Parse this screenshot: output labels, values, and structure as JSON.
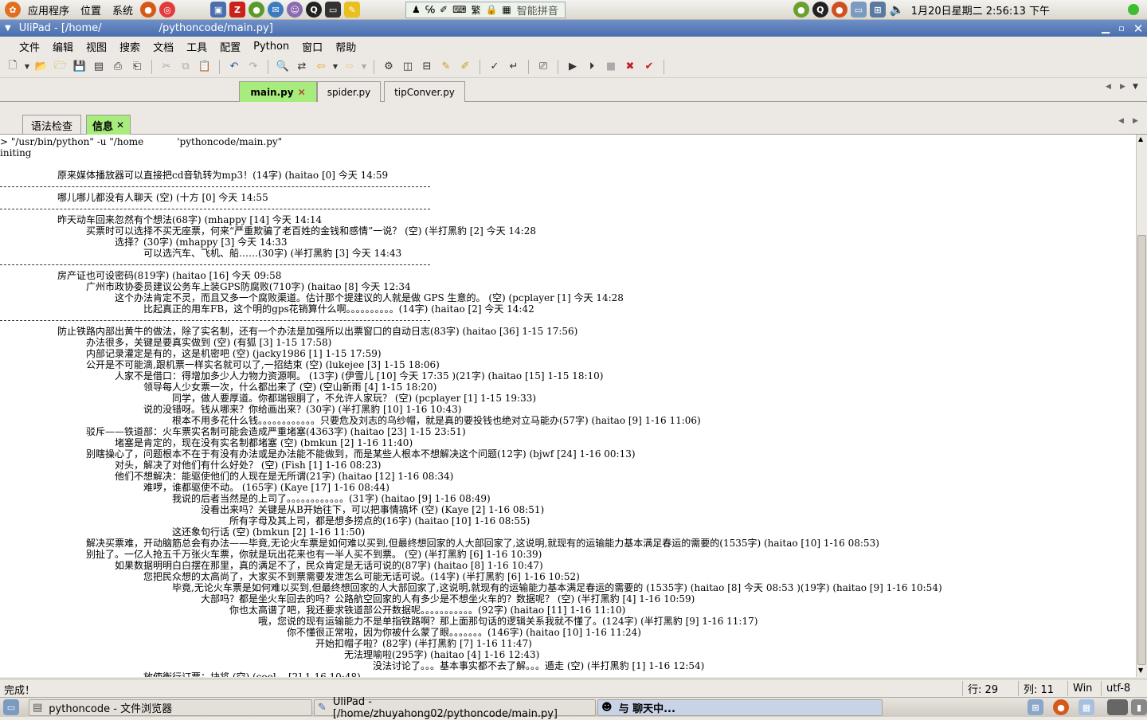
{
  "top_panel": {
    "menus": [
      "应用程序",
      "位置",
      "系统"
    ],
    "ime_label": "智能拼音",
    "clock": "1月20日星期二  2:56:13 下午"
  },
  "window": {
    "title_left": "UliPad - [/home/",
    "title_right": "/pythoncode/main.py]"
  },
  "menubar": [
    "文件",
    "编辑",
    "视图",
    "搜索",
    "文档",
    "工具",
    "配置",
    "Python",
    "窗口",
    "帮助"
  ],
  "editor_tabs": [
    {
      "label": "main.py",
      "active": true
    },
    {
      "label": "spider.py",
      "active": false
    },
    {
      "label": "tipConver.py",
      "active": false
    }
  ],
  "panel_tabs": [
    {
      "label": "语法检查",
      "active": false
    },
    {
      "label": "信息",
      "active": true
    }
  ],
  "output_lines": [
    {
      "indent": 0,
      "text": "> \"/usr/bin/python\" -u \"/home           'pythoncode/main.py\""
    },
    {
      "indent": 0,
      "text": "initing"
    },
    {
      "indent": 0,
      "text": ""
    },
    {
      "indent": 1,
      "text": "原来媒体播放器可以直接把cd音轨转为mp3！(14字) (haitao [0] 今天 14:59"
    },
    {
      "indent": -1,
      "text": ""
    },
    {
      "indent": 1,
      "text": "哪儿哪儿都没有人聊天 (空) (十方 [0] 今天 14:55"
    },
    {
      "indent": -1,
      "text": ""
    },
    {
      "indent": 1,
      "text": "昨天动车回来忽然有个想法(68字) (mhappy [14] 今天 14:14"
    },
    {
      "indent": 2,
      "text": "买票时可以选择不买无座票，何来“严重欺骗了老百姓的金钱和感情”一说？ (空) (半打黑豹 [2] 今天 14:28"
    },
    {
      "indent": 3,
      "text": "选择？(30字) (mhappy [3] 今天 14:33"
    },
    {
      "indent": 4,
      "text": "可以选汽车、飞机、船……(30字) (半打黑豹 [3] 今天 14:43"
    },
    {
      "indent": -1,
      "text": ""
    },
    {
      "indent": 1,
      "text": "房产证也可设密码(819字) (haitao [16] 今天 09:58"
    },
    {
      "indent": 2,
      "text": "广州市政协委员建议公务车上装GPS防腐败(710字) (haitao [8] 今天 12:34"
    },
    {
      "indent": 3,
      "text": "这个办法肯定不灵，而且又多一个腐败渠道。估计那个提建议的人就是做 GPS 生意的。 (空) (pcplayer [1] 今天 14:28"
    },
    {
      "indent": 4,
      "text": "比起真正的用车FB，这个明的gps花销算什么啊。。。。。。。。。。(14字) (haitao [2] 今天 14:42"
    },
    {
      "indent": -1,
      "text": ""
    },
    {
      "indent": 1,
      "text": "防止铁路内部出黄牛的做法，除了实名制，还有一个办法是加强所以出票窗口的自动日志(83字) (haitao [36] 1-15 17:56)"
    },
    {
      "indent": 2,
      "text": "办法很多，关键是要真实做到 (空) (有狐 [3] 1-15 17:58)"
    },
    {
      "indent": 2,
      "text": "内部记录灌定是有的，这是机密吧 (空) (jacky1986 [1] 1-15 17:59)"
    },
    {
      "indent": 2,
      "text": "公开是不可能滴,跟机票一样实名就可以了,一招结束 (空) (lukejee [3] 1-15 18:06)"
    },
    {
      "indent": 3,
      "text": "人家不是借口：得增加多少人力物力资源啊。 (13字) (伊雪儿 [10] 今天 17:35 )(21字) (haitao [15] 1-15 18:10)"
    },
    {
      "indent": 4,
      "text": "领导每人少女票一次，什么都出来了 (空) (空山新雨 [4] 1-15 18:20)"
    },
    {
      "indent": 5,
      "text": "同学，做人要厚道。你都瑞银胴了，不允许人家玩？ (空) (pcplayer [1] 1-15 19:33)"
    },
    {
      "indent": 4,
      "text": "说的没错呀。钱从哪来？你给画出来？(30字) (半打黑豹 [10] 1-16 10:43)"
    },
    {
      "indent": 5,
      "text": "根本不用多花什么钱。。。。。。。。。。。。只要危及刘志的乌纱帽，就是真的要投钱也绝对立马能办(57字) (haitao [9] 1-16 11:06)"
    },
    {
      "indent": 2,
      "text": "驳斥——铁道部：火车票实名制可能会造成严重堵塞(4363字) (haitao [23] 1-15 23:51)"
    },
    {
      "indent": 3,
      "text": "堵塞是肯定的，现在没有实名制都堵塞 (空) (bmkun [2] 1-16 11:40)"
    },
    {
      "indent": 2,
      "text": "别瞎操心了，问题根本不在于有没有办法或是办法能不能做到，而是某些人根本不想解决这个问题(12字) (bjwf [24] 1-16 00:13)"
    },
    {
      "indent": 3,
      "text": "对头，解决了对他们有什么好处？ (空) (Fish [1] 1-16 08:23)"
    },
    {
      "indent": 3,
      "text": "他们不想解决：能驱使他们的人现在是无所谓(21字) (haitao [12] 1-16 08:34)"
    },
    {
      "indent": 4,
      "text": "难啰，谁都驱使不动。 (165字) (Kaye [17] 1-16 08:44)"
    },
    {
      "indent": 5,
      "text": "我说的后者当然是的上司了。。。。。。。。。。。。(31字) (haitao [9] 1-16 08:49)"
    },
    {
      "indent": 6,
      "text": "没看出来吗？关键是从B开始往下，可以把事情搞坏 (空) (Kaye [2] 1-16 08:51)"
    },
    {
      "indent": 7,
      "text": "所有字母及其上司，都是想多捞点的(16字) (haitao [10] 1-16 08:55)"
    },
    {
      "indent": 5,
      "text": "这还象句行话 (空) (bmkun [2] 1-16 11:50)"
    },
    {
      "indent": 2,
      "text": "解决买票难，开动脑筋总会有办法——毕竟,无论火车票是如何难以买到,但最终想回家的人大部回家了,这说明,就现有的运输能力基本满足春运的需要的(1535字) (haitao [10] 1-16 08:53)"
    },
    {
      "indent": 2,
      "text": "别扯了。一亿人抢五千万张火车票，你就是玩出花来也有一半人买不到票。 (空) (半打黑豹 [6] 1-16 10:39)"
    },
    {
      "indent": 3,
      "text": "如果数据明明白白摆在那里，真的满足不了，民众肯定是无话可说的(87字) (haitao [8] 1-16 10:47)"
    },
    {
      "indent": 4,
      "text": "您把民众想的太高尚了，大家买不到票需要发泄怎么可能无话可说。(14字) (半打黑豹 [6] 1-16 10:52)"
    },
    {
      "indent": 5,
      "text": "毕竟,无论火车票是如何难以买到,但最终想回家的人大部回家了,这说明,就现有的运输能力基本满足春运的需要的 (1535字) (haitao [8] 今天 08:53 )(19字) (haitao [9] 1-16 10:54)"
    },
    {
      "indent": 6,
      "text": "大部吗？都是坐火车回去的吗？公路航空回家的人有多少是不想坐火车的？数据呢？ (空) (半打黑豹 [4] 1-16 10:59)"
    },
    {
      "indent": 7,
      "text": "你也太高谱了吧，我还要求铁道部公开数据呢。。。。。。。。。。。(92字) (haitao [11] 1-16 11:10)"
    },
    {
      "indent": 8,
      "text": "哦，您说的现有运输能力不是单指铁路啊？那上面那句话的逻辑关系我就不懂了。(124字) (半打黑豹 [9] 1-16 11:17)"
    },
    {
      "indent": 9,
      "text": "你不懂很正常啦，因为你被什么蒙了眼。。。。。。。(146字) (haitao [10] 1-16 11:24)"
    },
    {
      "indent": 10,
      "text": "开始扣帽子啦？(82字) (半打黑豹 [7] 1-16 11:47)"
    },
    {
      "indent": 11,
      "text": "无法理喻啦(295字) (haitao [4] 1-16 12:43)"
    },
    {
      "indent": 12,
      "text": "没法讨论了。。。基本事实都不去了解。。。遁走 (空) (半打黑豹 [1] 1-16 12:54)"
    },
    {
      "indent": 4,
      "text": "放使衡行订票：块将 (空) (cool... [2] 1-16 10:48)"
    }
  ],
  "status": {
    "message": "完成！",
    "line": "行: 29",
    "col": "列: 11",
    "eol": "Win",
    "encoding": "utf-8"
  },
  "taskbar": {
    "items": [
      {
        "label": "pythoncode - 文件浏览器",
        "active": false
      },
      {
        "label": "UliPad - [/home/zhuyahong02/pythoncode/main.py]",
        "active": false
      },
      {
        "label": "与                聊天中...",
        "active": true
      }
    ]
  },
  "colors": {
    "title_bar": "#5a7fbd",
    "active_tab": "#a8ec7e",
    "panel_bg": "#ece9e4"
  }
}
